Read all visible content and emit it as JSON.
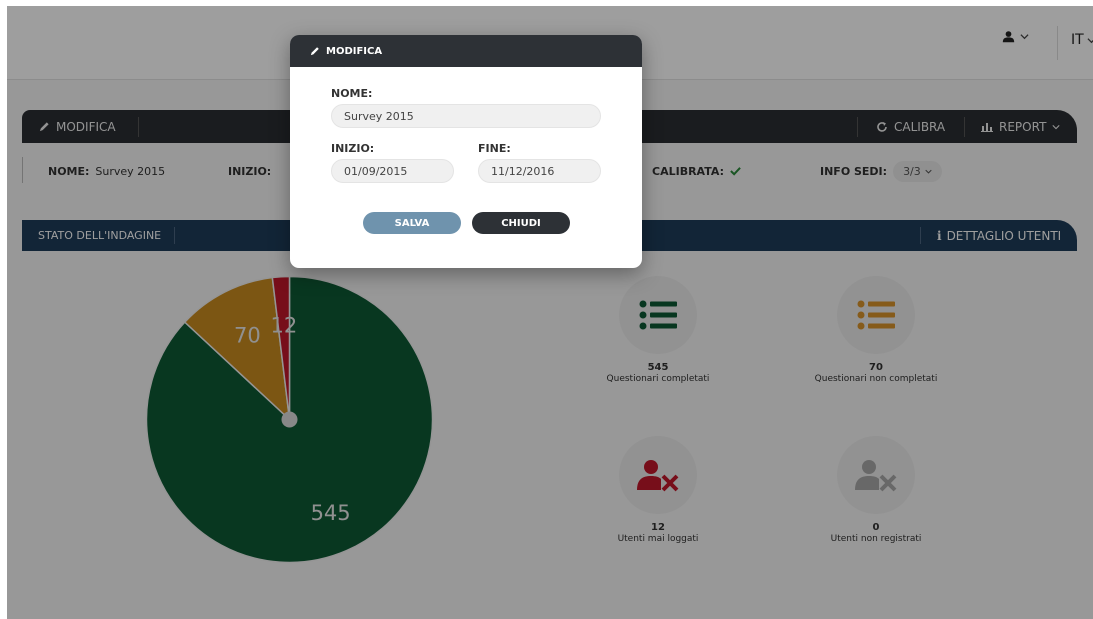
{
  "header": {
    "language": "IT"
  },
  "toolbar": {
    "edit_label": "MODIFICA",
    "calibrate_label": "CALIBRA",
    "report_label": "REPORT"
  },
  "info": {
    "name_label": "NOME:",
    "name_value": "Survey 2015",
    "start_label": "INIZIO:",
    "calibrated_label": "CALIBRATA:",
    "sites_label": "INFO SEDI:",
    "sites_value": "3/3"
  },
  "status_bar": {
    "title": "STATO DELL'INDAGINE",
    "user_detail_label": "DETTAGLIO UTENTI"
  },
  "chart_data": {
    "type": "pie",
    "slices": [
      {
        "label": "545",
        "value": 545,
        "color": "#0d5a35"
      },
      {
        "label": "70",
        "value": 70,
        "color": "#c98c1f"
      },
      {
        "label": "12",
        "value": 12,
        "color": "#c0182a"
      }
    ]
  },
  "stats": [
    {
      "value": "545",
      "label": "Questionari completati",
      "icon": "list-icon",
      "color": "#0d5a35"
    },
    {
      "value": "70",
      "label": "Questionari non completati",
      "icon": "list-icon",
      "color": "#d8942a"
    },
    {
      "value": "12",
      "label": "Utenti mai loggati",
      "icon": "user-x-icon",
      "color": "#c0182a"
    },
    {
      "value": "0",
      "label": "Utenti non registrati",
      "icon": "user-x-icon",
      "color": "#a8a8a8"
    }
  ],
  "modal": {
    "title": "MODIFICA",
    "name_label": "NOME:",
    "name_value": "Survey 2015",
    "start_label": "INIZIO:",
    "start_value": "01/09/2015",
    "end_label": "FINE:",
    "end_value": "11/12/2016",
    "save_label": "SALVA",
    "close_label": "CHIUDI"
  },
  "colors": {
    "accent_dark": "#2b2e33",
    "status_bar": "#1e3c5a",
    "check": "#2a8a3a"
  }
}
